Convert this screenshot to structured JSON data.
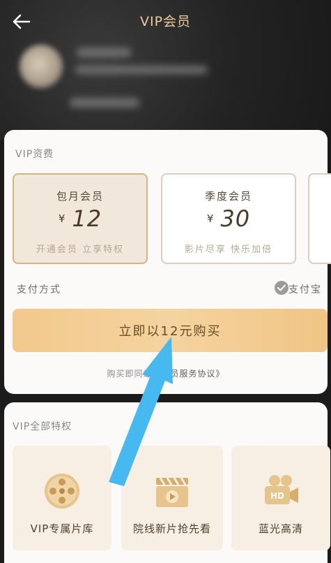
{
  "header": {
    "title": "VIP会员",
    "back_icon": "arrow-left-icon"
  },
  "plans_section": {
    "label": "VIP资费",
    "plans": [
      {
        "name": "包月会员",
        "currency": "¥",
        "price": "12",
        "desc": "开通会员 立享特权",
        "selected": true
      },
      {
        "name": "季度会员",
        "currency": "¥",
        "price": "30",
        "desc": "影片尽享 快乐加倍",
        "selected": false
      }
    ]
  },
  "payment": {
    "label": "支付方式",
    "method": "支付宝",
    "checked": true
  },
  "buy_button": {
    "label": "立即以12元购买"
  },
  "agreement": {
    "prefix": "购买即同意",
    "link": "《会员服务协议》"
  },
  "privileges": {
    "label": "VIP全部特权",
    "items": [
      {
        "label": "VIP专属片库",
        "icon": "film-reel-icon"
      },
      {
        "label": "院线新片抢先看",
        "icon": "clapperboard-icon"
      },
      {
        "label": "蓝光高清",
        "icon": "hd-camera-icon"
      }
    ]
  },
  "colors": {
    "gold": "#e9cc97",
    "button": "#f2c98d",
    "annotation_arrow": "#46b9f0"
  }
}
